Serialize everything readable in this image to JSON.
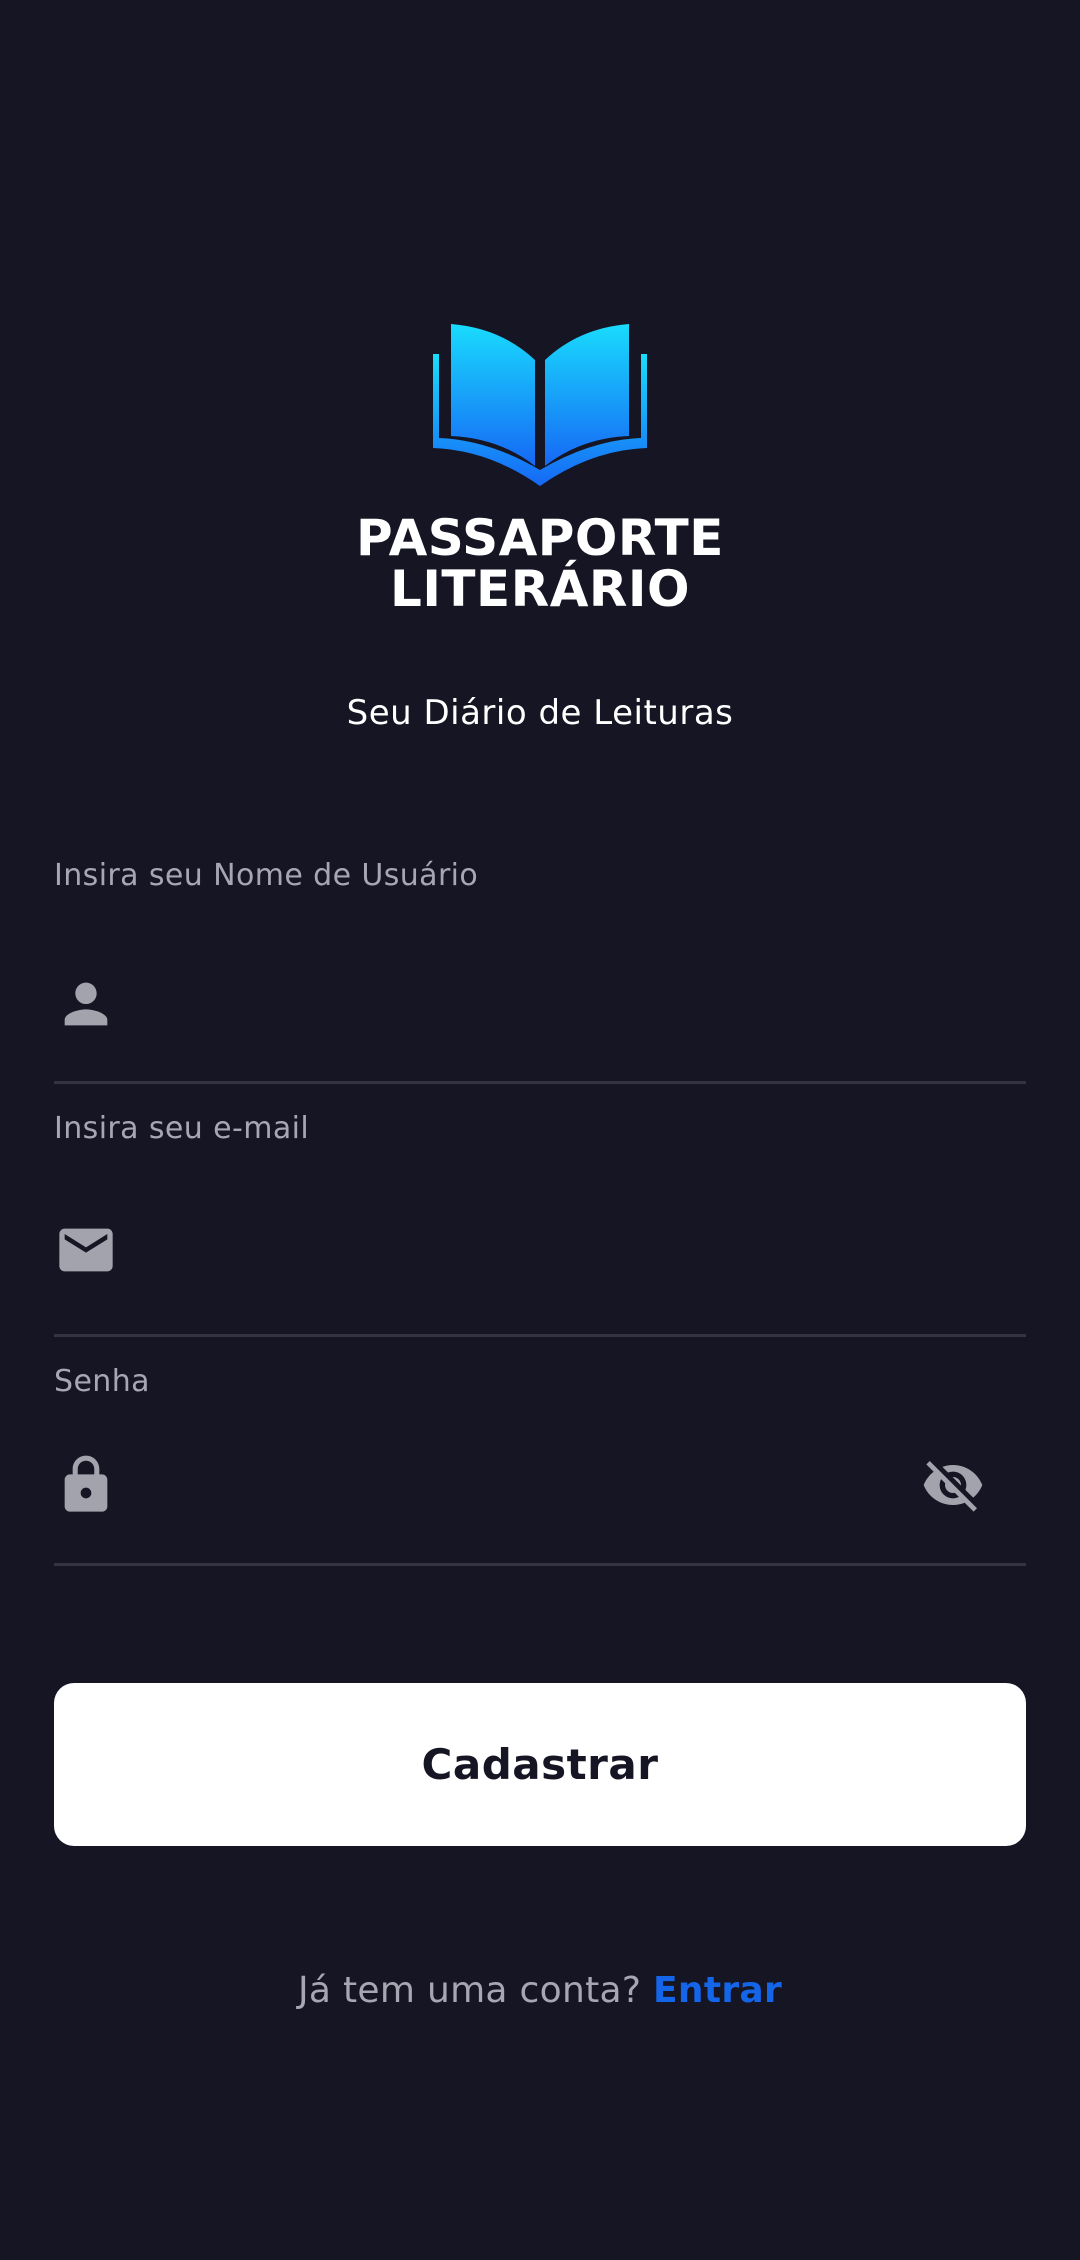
{
  "app": {
    "brand_line1": "PASSAPORTE",
    "brand_line2": "LITERÁRIO",
    "tagline": "Seu Diário de Leituras",
    "logo_icon": "open-book-icon"
  },
  "form": {
    "username": {
      "label": "Insira seu Nome de Usuário",
      "value": "",
      "icon": "person-icon"
    },
    "email": {
      "label": "Insira seu e-mail",
      "value": "",
      "icon": "mail-icon"
    },
    "password": {
      "label": "Senha",
      "value": "",
      "icon": "lock-icon",
      "toggle_icon": "visibility-off-icon"
    },
    "submit_label": "Cadastrar"
  },
  "footer": {
    "question": "Já tem uma conta?",
    "link_label": "Entrar"
  },
  "colors": {
    "background": "#151524",
    "accent": "#1565e8",
    "logo_gradient_top": "#19dcfd",
    "logo_gradient_bottom": "#1668f5",
    "label": "#a7a7b4",
    "icon": "#a3a3ad",
    "divider": "#333342",
    "button_bg": "#ffffff",
    "button_text": "#151524"
  }
}
